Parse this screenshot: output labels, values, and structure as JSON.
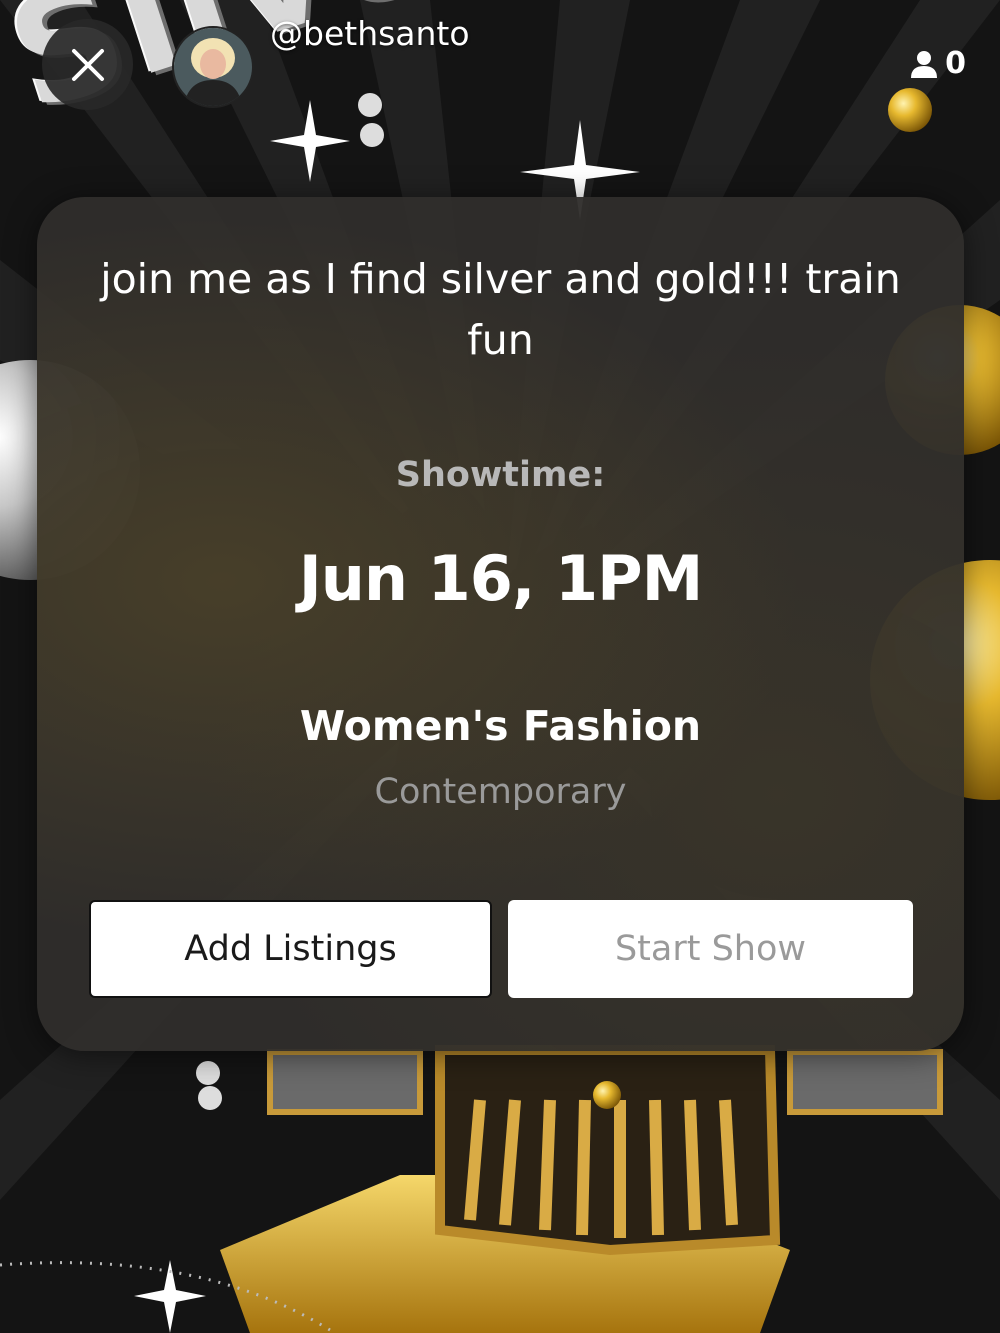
{
  "header": {
    "handle": "@bethsanto",
    "viewer_count": "0"
  },
  "background": {
    "logo_text_line": "Silver & Gold"
  },
  "show": {
    "title": "join me as I find silver and gold!!! train fun",
    "showtime_label": "Showtime:",
    "showtime_value": "Jun 16, 1PM",
    "category": "Women's Fashion",
    "subcategory": "Contemporary"
  },
  "actions": {
    "add_listings_label": "Add Listings",
    "start_show_label": "Start Show"
  },
  "icons": {
    "close": "close-icon",
    "viewers": "person-icon"
  },
  "colors": {
    "card_bg": "#302e2c",
    "gold": "#d4a52a",
    "button_bg": "#ffffff",
    "disabled_text": "#9a9a9a"
  }
}
